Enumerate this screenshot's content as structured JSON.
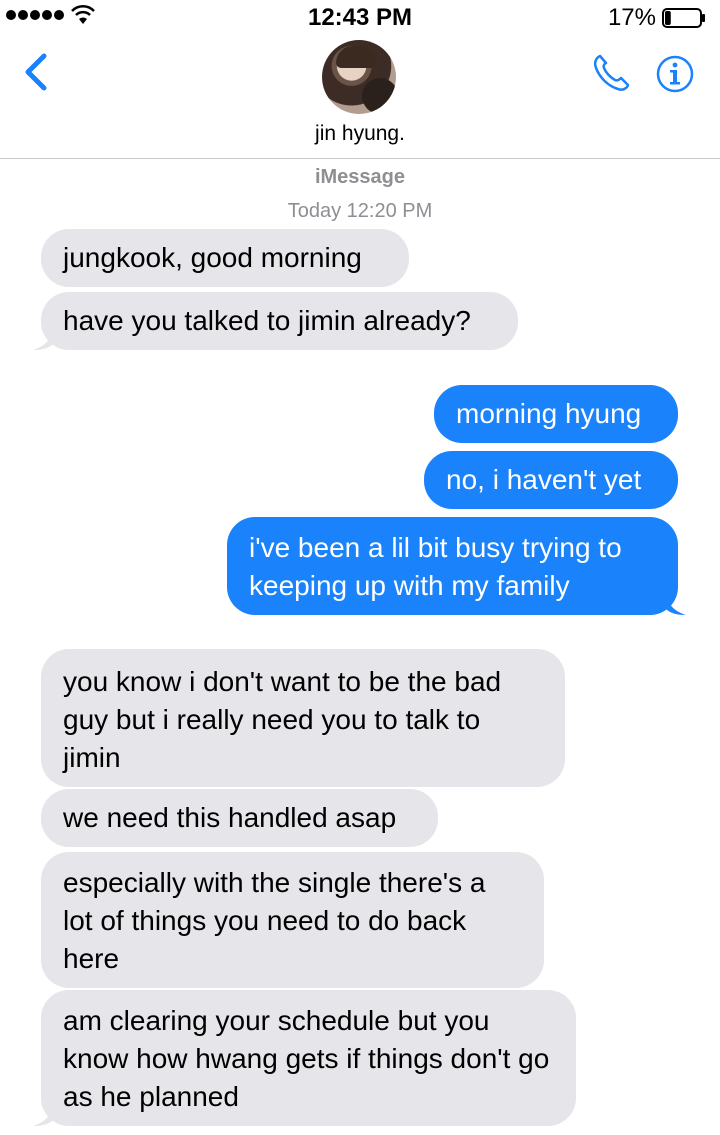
{
  "status_bar": {
    "time": "12:43 PM",
    "battery_percent": "17%",
    "battery_level": 0.17,
    "signal_bars": 5
  },
  "header": {
    "contact_name": "jin hyung.",
    "avatar_icon": "contact-photo",
    "back_icon": "chevron-left-icon",
    "call_icon": "phone-icon",
    "info_icon": "info-icon"
  },
  "conversation": {
    "service": "iMessage",
    "timestamp": "Today 12:20 PM",
    "messages": [
      {
        "from": "them",
        "text": "jungkook, good morning"
      },
      {
        "from": "them",
        "text": "have you talked to jimin already?"
      },
      {
        "from": "me",
        "text": "morning hyung"
      },
      {
        "from": "me",
        "text": "no, i haven't yet"
      },
      {
        "from": "me",
        "text": "i've been a lil bit busy trying to keeping up with my family"
      },
      {
        "from": "them",
        "text": "you know i don't want to be the bad guy but i really need you to talk to jimin"
      },
      {
        "from": "them",
        "text": "we need this handled asap"
      },
      {
        "from": "them",
        "text": "especially with the single there's a lot of things you need to do back here"
      },
      {
        "from": "them",
        "text": "am clearing your schedule but you know how hwang gets if things don't go as he planned"
      }
    ]
  },
  "colors": {
    "accent": "#1a82fb",
    "incoming_bubble": "#e5e5ea",
    "secondary_text": "#8e8e93"
  }
}
